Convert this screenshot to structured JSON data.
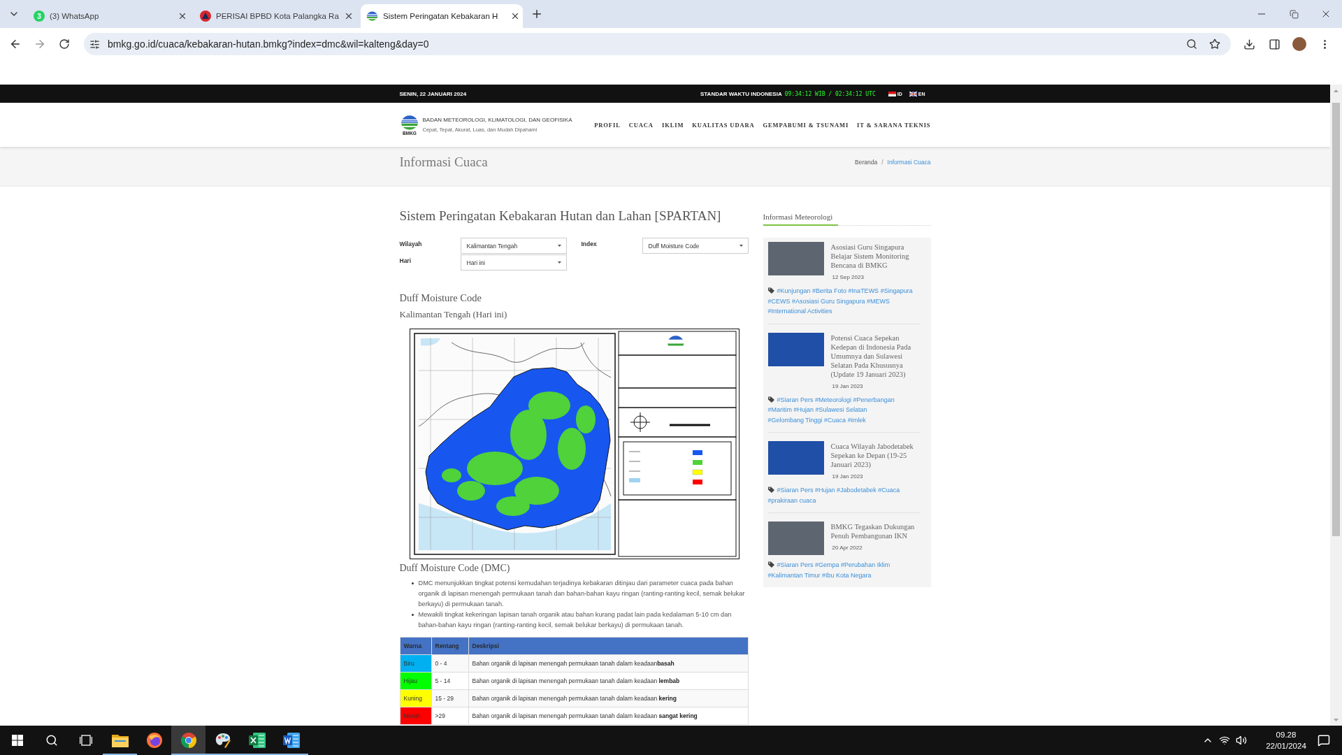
{
  "browser": {
    "tabs": [
      {
        "title": "(3) WhatsApp",
        "kind": "chat",
        "badge": "3",
        "selected": false
      },
      {
        "title": "PERISAI BPBD Kota Palangka Ra",
        "kind": "emblem",
        "selected": false
      },
      {
        "title": "Sistem Peringatan Kebakaran H",
        "kind": "logo",
        "selected": true
      }
    ],
    "url": "bmkg.go.id/cuaca/kebakaran-hutan.bmkg?index=dmc&wil=kalteng&day=0"
  },
  "top_bar": {
    "date": "SENIN, 22 JANUARI 2024",
    "clock_label": "STANDAR WAKTU INDONESIA",
    "clock": "09:34:12 WIB / 02:34:12 UTC",
    "languages": [
      {
        "code": "ID",
        "kind": "indonesia"
      },
      {
        "code": "EN",
        "kind": "britain"
      }
    ]
  },
  "header": {
    "logo_text": "BMKG",
    "org_name": "BADAN METEOROLOGI, KLIMATOLOGI, DAN GEOFISIKA",
    "tagline": "Cepat, Tepat, Akurat, Luas, dan Mudah Dipahami",
    "nav": [
      "PROFIL",
      "CUACA",
      "IKLIM",
      "KUALITAS UDARA",
      "GEMPABUMI & TSUNAMI",
      "IT & SARANA TEKNIS"
    ]
  },
  "title_band": {
    "title": "Informasi Cuaca",
    "separator": "/",
    "breadcrumb": [
      {
        "label": "Beranda",
        "current": false
      },
      {
        "label": "Informasi Cuaca",
        "current": true
      }
    ]
  },
  "main": {
    "title": "Sistem Peringatan Kebakaran Hutan dan Lahan [SPARTAN]",
    "filter_columns": [
      [
        {
          "label": "Wilayah",
          "value": "Kalimantan Tengah"
        },
        {
          "label": "Hari",
          "value": "Hari ini"
        }
      ],
      [
        {
          "label": "Index",
          "value": "Duff Moisture Code"
        }
      ]
    ],
    "index_heading": "Duff Moisture Code",
    "region_heading": "Kalimantan Tengah (Hari ini)",
    "section_title": "Duff Moisture Code (DMC)",
    "bullets": [
      "DMC menunjukkan tingkat potensi kemudahan terjadinya kebakaran ditinjau dari parameter cuaca pada bahan organik di lapisan menengah permukaan tanah dan bahan-bahan kayu ringan (ranting-ranting kecil, semak belukar berkayu) di permukaan tanah.",
      "Mewakili tingkat kekeringan lapisan tanah organik atau bahan kurang padat lain pada kedalaman 5-10 cm dan bahan-bahan kayu ringan (ranting-ranting kecil, semak belukar berkayu) di permukaan tanah."
    ],
    "table": {
      "columns": [
        "Warna",
        "Rentang",
        "Deskripsi"
      ],
      "rows": [
        {
          "color_name": "Biru",
          "color": "#00b0f0",
          "range": "0 - 4",
          "description": "Bahan organik di lapisan menengah permukaan tanah dalam keadaan**basah**"
        },
        {
          "color_name": "Hijau",
          "color": "#00ff00",
          "range": "5 - 14",
          "description": "Bahan organik di lapisan menengah permukaan tanah dalam keadaan **lembab**"
        },
        {
          "color_name": "Kuning",
          "color": "#ffff00",
          "range": "15 - 29",
          "description": "Bahan organik di lapisan menengah permukaan tanah dalam keadaan **kering**"
        },
        {
          "color_name": "Merah",
          "color": "#ff0000",
          "range": ">29",
          "description": "Bahan organik di lapisan menengah permukaan tanah dalam keadaan **sangat kering**"
        }
      ]
    }
  },
  "sidebar": {
    "title": "Informasi Meteorologi",
    "articles": [
      {
        "kind": "photo",
        "title": "Asosiasi Guru Singapura Belajar Sistem Monitoring Bencana di BMKG",
        "date": "12 Sep 2023",
        "tags": [
          "#Kunjungan",
          "#Berita Foto",
          "#InaTEWS",
          "#Singapura",
          "#CEWS",
          "#Asosiasi Guru Singapura",
          "#MEWS",
          "#International Activities"
        ]
      },
      {
        "kind": "satellite",
        "title": "Potensi Cuaca Sepekan Kedepan di Indonesia Pada Umumnya dan Sulawesi Selatan Pada Khususnya (Update 19 Januari 2023)",
        "date": "19 Jan 2023",
        "tags": [
          "#Siaran Pers",
          "#Meteorologi",
          "#Penerbangan",
          "#Maritim",
          "#Hujan",
          "#Sulawesi Selatan",
          "#Gelombang Tinggi",
          "#Cuaca",
          "#imlek"
        ]
      },
      {
        "kind": "satellite",
        "title": "Cuaca Wilayah Jabodetabek Sepekan ke Depan (19-25 Januari 2023)",
        "date": "19 Jan 2023",
        "tags": [
          "#Siaran Pers",
          "#Hujan",
          "#Jabodetabek",
          "#Cuaca",
          "#prakiraan cuaca"
        ]
      },
      {
        "kind": "photo",
        "title": "BMKG Tegaskan Dukungan Penuh Pembangunan IKN",
        "date": "20 Apr 2022",
        "tags": [
          "#Siaran Pers",
          "#Gempa",
          "#Perubahan Iklim",
          "#Kalimantan Timur",
          "#Ibu Kota Negara"
        ]
      }
    ]
  },
  "taskbar": {
    "apps": [
      {
        "kind": "explorer",
        "running": true,
        "selected": false
      },
      {
        "kind": "firefox",
        "running": false,
        "selected": false
      },
      {
        "kind": "chrome",
        "running": true,
        "selected": true
      },
      {
        "kind": "paint",
        "running": true,
        "selected": false
      },
      {
        "kind": "excel",
        "running": true,
        "selected": false
      },
      {
        "kind": "word",
        "running": true,
        "selected": false
      }
    ],
    "time": "09.28",
    "date": "22/01/2024"
  }
}
